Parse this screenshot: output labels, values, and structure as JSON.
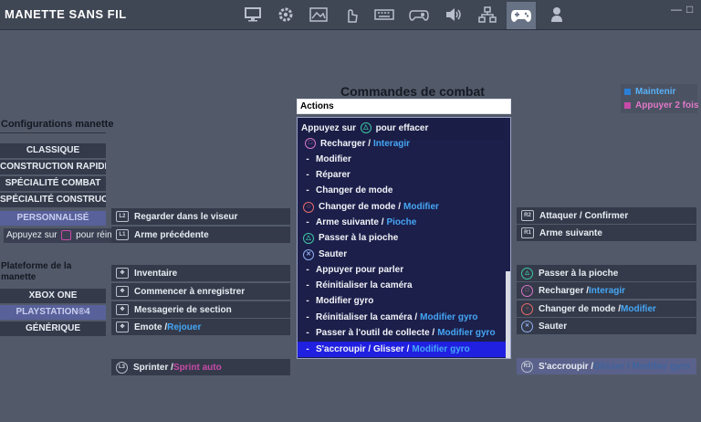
{
  "app": {
    "title": "MANETTE SANS FIL"
  },
  "nav_icons": [
    {
      "name": "monitor-icon"
    },
    {
      "name": "gear-icon"
    },
    {
      "name": "display-icon"
    },
    {
      "name": "touch-icon"
    },
    {
      "name": "keyboard-icon"
    },
    {
      "name": "gamepad-settings-icon"
    },
    {
      "name": "speaker-icon"
    },
    {
      "name": "network-icon"
    },
    {
      "name": "controller-icon"
    },
    {
      "name": "account-icon"
    }
  ],
  "window": {
    "minimize": "—",
    "maximize": "□"
  },
  "config": {
    "title": "Configurations manette",
    "items": [
      "CLASSIQUE",
      "CONSTRUCTION RAPIDE",
      "SPÉCIALITÉ COMBAT",
      "SPÉCIALITÉ CONSTRUCTI…",
      "PERSONNALISÉ"
    ],
    "selected": "PERSONNALISÉ",
    "erase_hint_prefix": "Appuyez sur",
    "erase_hint_suffix": "pour réini"
  },
  "platform": {
    "title_line1": "Plateforme de la",
    "title_line2": "manette",
    "items": [
      "XBOX ONE",
      "PLAYSTATION®4",
      "GÉNÉRIQUE"
    ],
    "selected": "PLAYSTATION®4"
  },
  "panel": {
    "title": "Commandes de combat",
    "actions_value": "Actions"
  },
  "dropdown": {
    "header_prefix": "Appuyez sur",
    "header_suffix": "pour effacer",
    "partial_item": {
      "text": "Recharger / ",
      "highlight": "Interagir"
    },
    "items": [
      {
        "bullet": "-",
        "text": "Modifier",
        "highlight": ""
      },
      {
        "bullet": "-",
        "text": "Réparer",
        "highlight": ""
      },
      {
        "bullet": "-",
        "text": "Changer de mode",
        "highlight": ""
      },
      {
        "bullet": "circle",
        "text": "Changer de mode / ",
        "highlight": "Modifier"
      },
      {
        "bullet": "-",
        "text": "Arme suivante / ",
        "highlight": "Pioche"
      },
      {
        "bullet": "triangle",
        "text": "Passer à la pioche",
        "highlight": ""
      },
      {
        "bullet": "cross",
        "text": "Sauter",
        "highlight": ""
      },
      {
        "bullet": "-",
        "text": "Appuyer pour parler",
        "highlight": ""
      },
      {
        "bullet": "-",
        "text": "Réinitialiser la caméra",
        "highlight": ""
      },
      {
        "bullet": "-",
        "text": "Modifier gyro",
        "highlight": ""
      },
      {
        "bullet": "-",
        "text": "Réinitialiser la caméra / ",
        "highlight": "Modifier gyro"
      },
      {
        "bullet": "-",
        "text": "Passer à l'outil de collecte / ",
        "highlight": "Modifier gyro"
      },
      {
        "bullet": "-",
        "text": "S'accroupir / Glisser / ",
        "highlight": "Modifier gyro"
      }
    ],
    "selected_index": 12
  },
  "legend": {
    "hold": "Maintenir",
    "double": "Appuyer 2 fois",
    "hold_color": "#2a7fd4",
    "double_color": "#c84aa8"
  },
  "left_bindings": [
    {
      "icon": "L2",
      "text": "Regarder dans le viseur",
      "extra": ""
    },
    {
      "icon": "L1",
      "text": "Arme précédente",
      "extra": ""
    },
    {
      "icon": "✥",
      "text": "Inventaire",
      "extra": ""
    },
    {
      "icon": "✥",
      "text": "Commencer à enregistrer",
      "extra": ""
    },
    {
      "icon": "✥",
      "text": "Messagerie de section",
      "extra": ""
    },
    {
      "icon": "✥",
      "text": "Emote / ",
      "extra": "Rejouer"
    },
    {
      "icon": "L3",
      "text": "Sprinter / ",
      "extra": "Sprint auto"
    }
  ],
  "right_bindings": [
    {
      "icon": "R2",
      "text": "Attaquer / Confirmer",
      "extra": ""
    },
    {
      "icon": "R1",
      "text": "Arme suivante",
      "extra": ""
    },
    {
      "icon": "△",
      "text": "Passer à la pioche",
      "extra": ""
    },
    {
      "icon": "□",
      "text": "Recharger / ",
      "extra": "Interagir"
    },
    {
      "icon": "○",
      "text": "Changer de mode / ",
      "extra": "Modifier"
    },
    {
      "icon": "✕",
      "text": "Sauter",
      "extra": ""
    },
    {
      "icon": "R3",
      "text": "S'accroupir / ",
      "extra": "Glisser / Modifier gyro"
    }
  ]
}
